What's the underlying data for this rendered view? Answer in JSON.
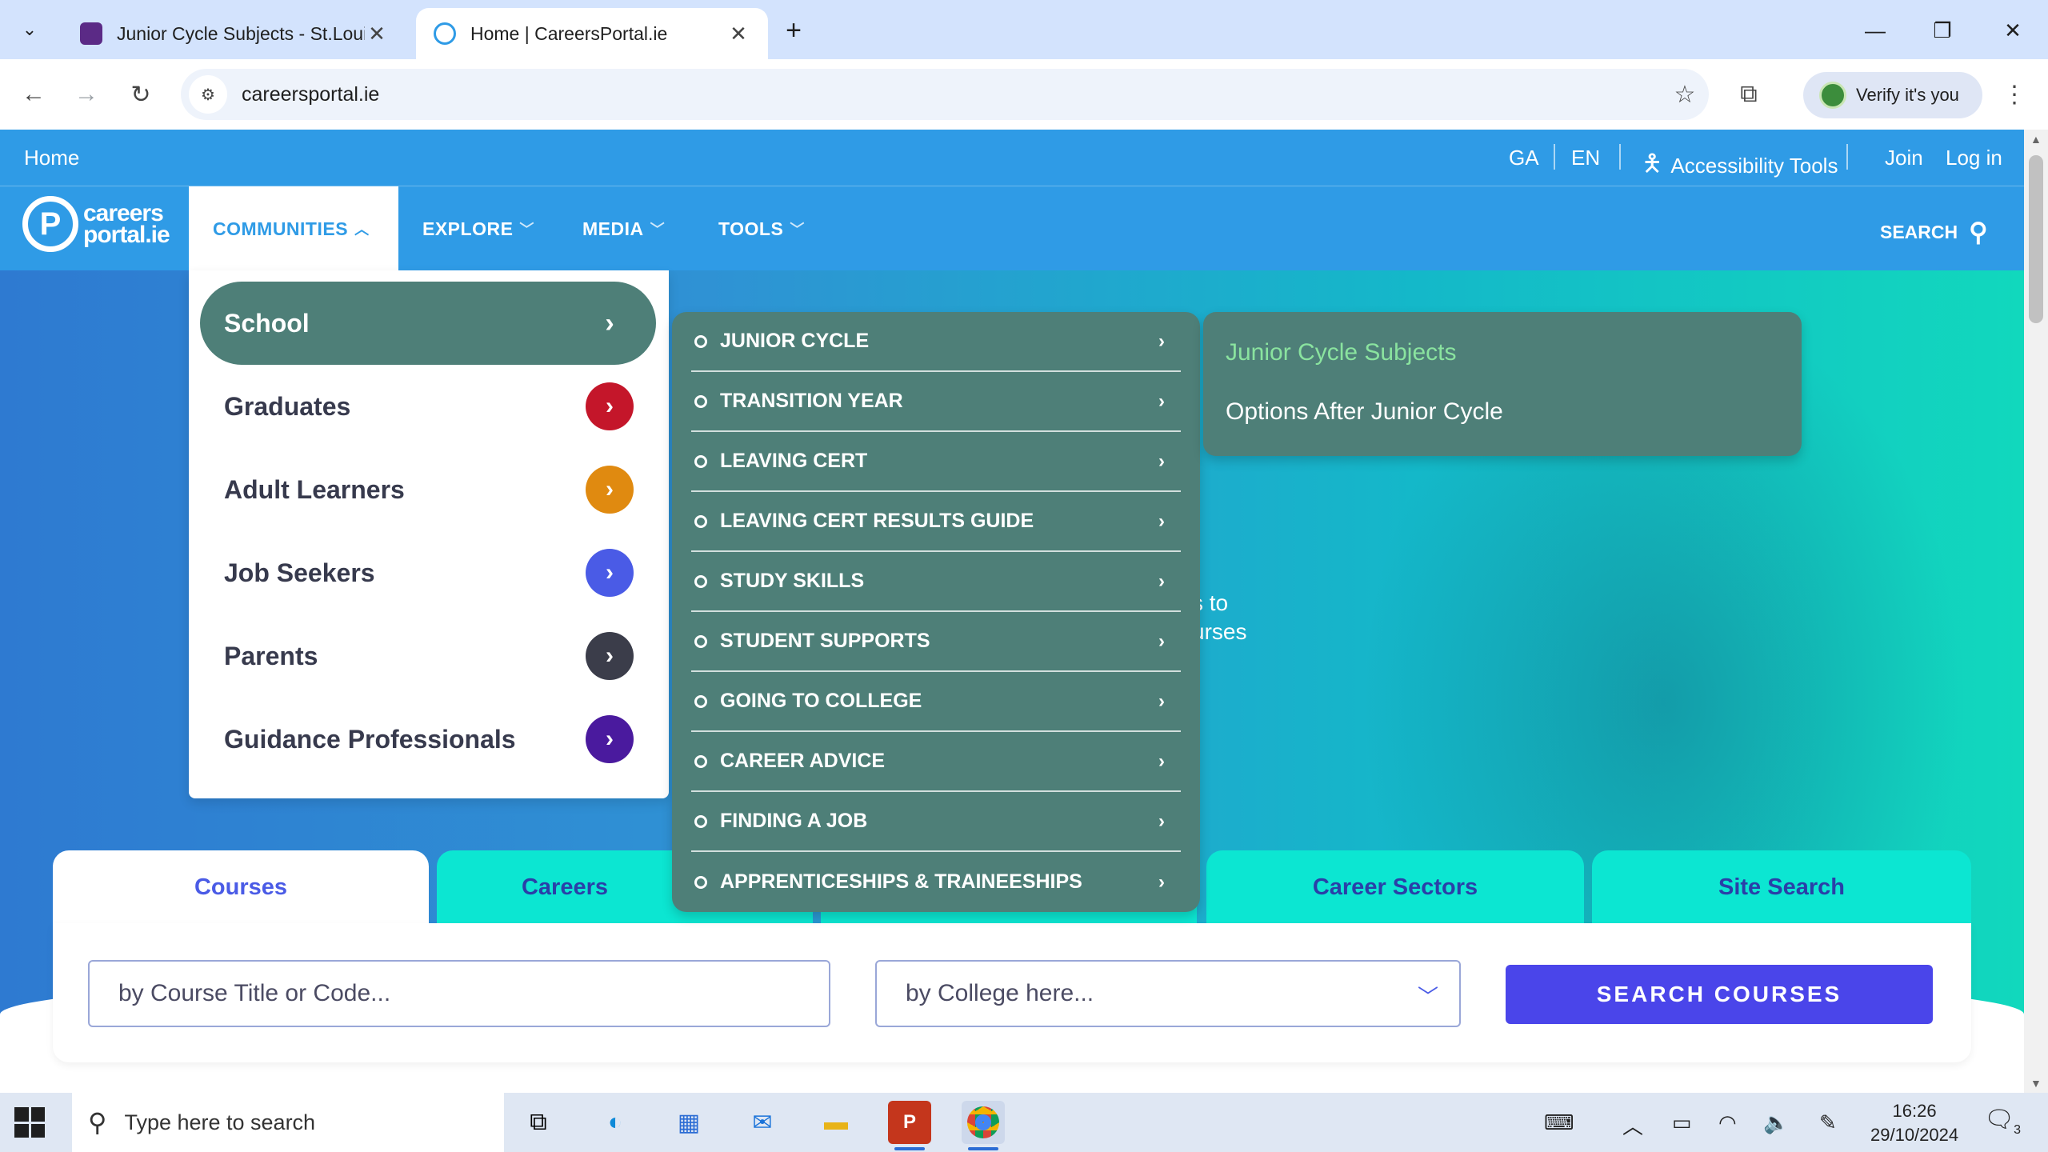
{
  "browser": {
    "tabs": [
      {
        "title": "Junior Cycle Subjects - St.Louis S",
        "active": false
      },
      {
        "title": "Home | CareersPortal.ie",
        "active": true
      }
    ],
    "url": "careersportal.ie",
    "profile_label": "Verify it's you"
  },
  "topbar": {
    "home": "Home",
    "lang_ga": "GA",
    "lang_en": "EN",
    "accessibility": "Accessibility Tools",
    "join": "Join",
    "login": "Log in"
  },
  "logo": {
    "line1": "careers",
    "line2": "portal.ie"
  },
  "nav": {
    "items": [
      "COMMUNITIES",
      "EXPLORE",
      "MEDIA",
      "TOOLS"
    ],
    "search": "SEARCH"
  },
  "communities": {
    "items": [
      {
        "label": "School",
        "color": "#4e7f78"
      },
      {
        "label": "Graduates",
        "color": "#c4162a"
      },
      {
        "label": "Adult Learners",
        "color": "#e08a10"
      },
      {
        "label": "Job Seekers",
        "color": "#4a5be6"
      },
      {
        "label": "Parents",
        "color": "#3b3d4a"
      },
      {
        "label": "Guidance Professionals",
        "color": "#4a1a9e"
      }
    ]
  },
  "school_menu": {
    "items": [
      "JUNIOR CYCLE",
      "TRANSITION YEAR",
      "LEAVING CERT",
      "LEAVING CERT RESULTS GUIDE",
      "STUDY SKILLS",
      "STUDENT SUPPORTS",
      "GOING TO COLLEGE",
      "CAREER ADVICE",
      "FINDING A JOB",
      "APPRENTICESHIPS & TRAINEESHIPS"
    ]
  },
  "junior_cycle_menu": {
    "items": [
      "Junior Cycle Subjects",
      "Options After Junior Cycle"
    ]
  },
  "hero": {
    "line1": "s to",
    "line2": "urses"
  },
  "search_tabs": [
    "Courses",
    "Careers",
    "",
    "Career Sectors",
    "Site Search"
  ],
  "search": {
    "course_placeholder": "by Course Title or Code...",
    "college_placeholder": "by College here...",
    "button": "SEARCH COURSES"
  },
  "taskbar": {
    "search_placeholder": "Type here to search",
    "time": "16:26",
    "date": "29/10/2024",
    "notifications": "3"
  },
  "colors": {
    "brand_blue": "#2f9be6",
    "menu_teal": "#4e7f78",
    "tab_cyan": "#0ce6d2",
    "button_indigo": "#4a45ea",
    "current_link_green": "#8ae39f"
  }
}
